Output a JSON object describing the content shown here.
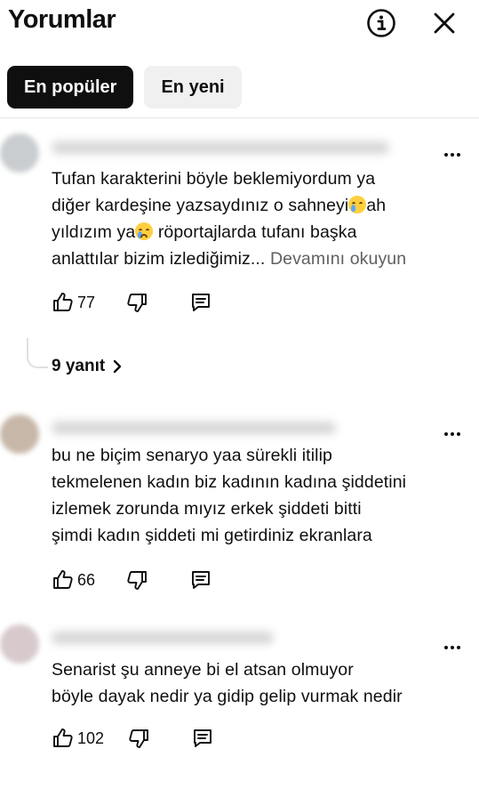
{
  "header": {
    "title": "Yorumlar",
    "info_icon": "info-circle-icon",
    "close_icon": "close-x-icon"
  },
  "chips": [
    {
      "label": "En popüler",
      "active": true
    },
    {
      "label": "En yeni",
      "active": false
    }
  ],
  "comments": [
    {
      "text_part1": "Tufan karakterini böyle beklemiyordum ya\ndiğer kardeşine yazsaydınız o sahneyi",
      "text_part2": "ah\nyıldızım ya",
      "text_part3": " röportajlarda tufanı başka\nanlattılar bizim izlediğimiz... ",
      "read_more": "Devamını okuyun",
      "likes": "77",
      "replies": "9 yanıt"
    },
    {
      "text": "bu ne biçim senaryo yaa sürekli itilip\ntekmelenen kadın biz kadının kadına şiddetini\nizlemek zorunda mıyız erkek şiddeti bitti\nşimdi kadın şiddeti mi getirdiniz ekranlara",
      "likes": "66"
    },
    {
      "text": "Senarist   şu anneye bi el atsan olmuyor\nböyle dayak nedir ya gidip gelip vurmak nedir",
      "likes": "102"
    }
  ],
  "icons": {
    "like": "thumbs-up-icon",
    "dislike": "thumbs-down-icon",
    "reply": "reply-comment-icon",
    "more": "more-vertical-icon",
    "chevron": "chevron-right-icon"
  },
  "colors": {
    "chip_active_bg": "#0f0f0f",
    "chip_inactive_bg": "#f0f0f0",
    "muted_text": "#606060"
  }
}
